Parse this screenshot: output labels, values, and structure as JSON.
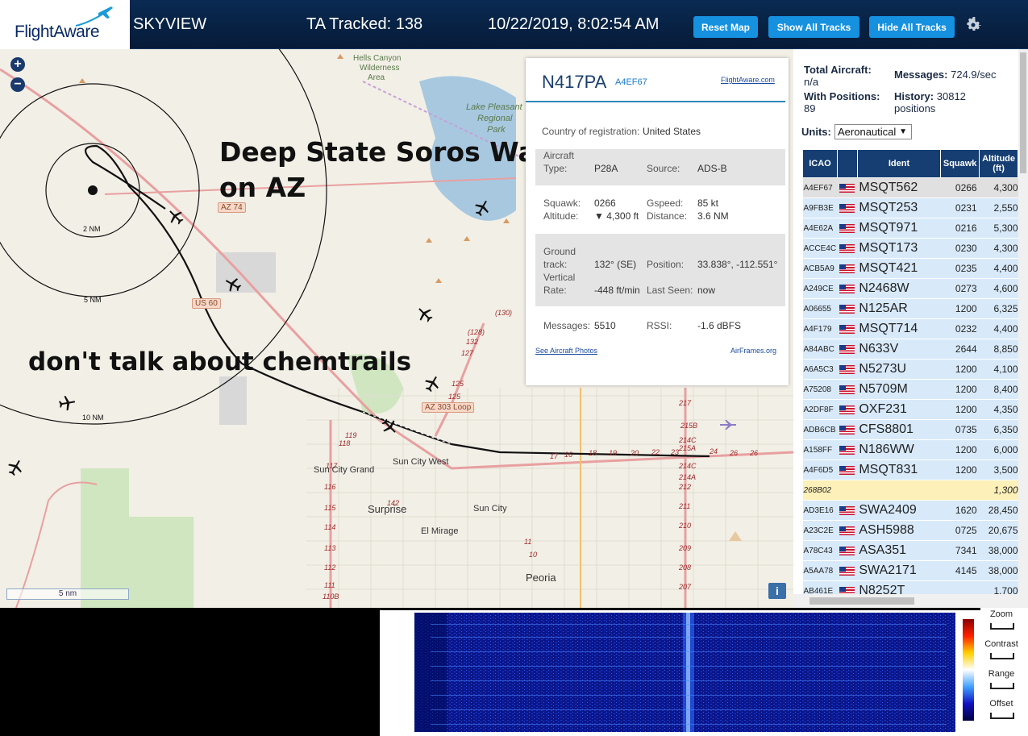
{
  "header": {
    "logo_text": "FlightAware",
    "app_name": "SKYVIEW",
    "tracked_label": "TA Tracked: 138",
    "datetime": "10/22/2019, 8:02:54 AM",
    "btn_reset": "Reset Map",
    "btn_show": "Show All Tracks",
    "btn_hide": "Hide All Tracks",
    "settings_icon": "gear-icon"
  },
  "map": {
    "zoom_in": "+",
    "zoom_out": "−",
    "overlay_line1": "Deep State Soros War",
    "overlay_line2": "on AZ",
    "overlay_line3": "don't talk about chemtrails",
    "labels": {
      "hells_canyon": "Hells Canyon",
      "wilderness": "Wilderness",
      "area": "Area",
      "lake_pleasant1": "Lake Pleasant",
      "lake_pleasant2": "Regional",
      "lake_pleasant3": "Park",
      "sun_city_grand": "Sun City Grand",
      "sun_city_west": "Sun City West",
      "surprise": "Surprise",
      "sun_city": "Sun City",
      "el_mirage": "El Mirage",
      "peoria": "Peoria",
      "ring_2nm": "2 NM",
      "ring_5nm": "5 NM",
      "ring_10nm": "10 NM"
    },
    "roads": {
      "az74": "AZ 74",
      "us60": "US 60",
      "az303": "AZ 303 Loop"
    },
    "scale": "5 nm",
    "info_button": "i"
  },
  "popup": {
    "registration": "N417PA",
    "icao": "A4EF67",
    "fa_link": "FlightAware.com",
    "country_label": "Country of registration:",
    "country_value": "United States",
    "aircraft_type_label1": "Aircraft",
    "aircraft_type_label2": "Type:",
    "aircraft_type": "P28A",
    "source_label": "Source:",
    "source": "ADS-B",
    "squawk_label": "Squawk:",
    "squawk": "0266",
    "gspeed_label": "Gspeed:",
    "gspeed": "85 kt",
    "altitude_label": "Altitude:",
    "altitude": "▼ 4,300 ft",
    "distance_label": "Distance:",
    "distance": "3.6 NM",
    "ground_label1": "Ground",
    "ground_label2": "track:",
    "ground_track": "132° (SE)",
    "position_label": "Position:",
    "position": "33.838°, -112.551°",
    "vrate_label1": "Vertical",
    "vrate_label2": "Rate:",
    "vrate": "-448 ft/min",
    "lastseen_label": "Last Seen:",
    "lastseen": "now",
    "messages_label": "Messages:",
    "messages": "5510",
    "rssi_label": "RSSI:",
    "rssi": "-1.6 dBFS",
    "photos_link": "See Aircraft Photos",
    "airframes_link": "AirFrames.org"
  },
  "sidebar": {
    "total_label": "Total Aircraft:",
    "total_value": "n/a",
    "messages_label": "Messages:",
    "messages_value": "724.9/sec",
    "withpos_label": "With Positions:",
    "withpos_value": "89",
    "history_label": "History:",
    "history_value": "30812",
    "history_unit": "positions",
    "units_label": "Units:",
    "units_value": "Aeronautical",
    "columns": [
      "ICAO",
      "",
      "Ident",
      "Squawk",
      "Altitude (ft)"
    ],
    "rows": [
      {
        "icao": "A4EF67",
        "flag": true,
        "ident": "MSQT562",
        "squawk": "0266",
        "alt": "4,300",
        "state": "sel"
      },
      {
        "icao": "A9FB3E",
        "flag": true,
        "ident": "MSQT253",
        "squawk": "0231",
        "alt": "2,550",
        "state": ""
      },
      {
        "icao": "A4E62A",
        "flag": true,
        "ident": "MSQT971",
        "squawk": "0216",
        "alt": "5,300",
        "state": ""
      },
      {
        "icao": "ACCE4C",
        "flag": true,
        "ident": "MSQT173",
        "squawk": "0230",
        "alt": "4,300",
        "state": ""
      },
      {
        "icao": "ACB5A9",
        "flag": true,
        "ident": "MSQT421",
        "squawk": "0235",
        "alt": "4,400",
        "state": ""
      },
      {
        "icao": "A249CE",
        "flag": true,
        "ident": "N2468W",
        "squawk": "0273",
        "alt": "4,600",
        "state": ""
      },
      {
        "icao": "A06655",
        "flag": true,
        "ident": "N125AR",
        "squawk": "1200",
        "alt": "6,325",
        "state": ""
      },
      {
        "icao": "A4F179",
        "flag": true,
        "ident": "MSQT714",
        "squawk": "0232",
        "alt": "4,400",
        "state": ""
      },
      {
        "icao": "A84ABC",
        "flag": true,
        "ident": "N633V",
        "squawk": "2644",
        "alt": "8,850",
        "state": ""
      },
      {
        "icao": "A6A5C3",
        "flag": true,
        "ident": "N5273U",
        "squawk": "1200",
        "alt": "4,100",
        "state": ""
      },
      {
        "icao": "A75208",
        "flag": true,
        "ident": "N5709M",
        "squawk": "1200",
        "alt": "8,400",
        "state": ""
      },
      {
        "icao": "A2DF8F",
        "flag": true,
        "ident": "OXF231",
        "squawk": "1200",
        "alt": "4,350",
        "state": ""
      },
      {
        "icao": "ADB6CB",
        "flag": true,
        "ident": "CFS8801",
        "squawk": "0735",
        "alt": "6,350",
        "state": ""
      },
      {
        "icao": "A158FF",
        "flag": true,
        "ident": "N186WW",
        "squawk": "1200",
        "alt": "6,000",
        "state": ""
      },
      {
        "icao": "A4F6D5",
        "flag": true,
        "ident": "MSQT831",
        "squawk": "1200",
        "alt": "3,500",
        "state": ""
      },
      {
        "icao": "268B02",
        "flag": false,
        "ident": "",
        "squawk": "",
        "alt": "1,300",
        "state": "nopos"
      },
      {
        "icao": "AD3E16",
        "flag": true,
        "ident": "SWA2409",
        "squawk": "1620",
        "alt": "28,450",
        "state": ""
      },
      {
        "icao": "A23C2E",
        "flag": true,
        "ident": "ASH5988",
        "squawk": "0725",
        "alt": "20,675",
        "state": ""
      },
      {
        "icao": "A78C43",
        "flag": true,
        "ident": "ASA351",
        "squawk": "7341",
        "alt": "38,000",
        "state": ""
      },
      {
        "icao": "A5AA78",
        "flag": true,
        "ident": "SWA2171",
        "squawk": "4145",
        "alt": "38,000",
        "state": ""
      },
      {
        "icao": "AB461E",
        "flag": true,
        "ident": "N8252T",
        "squawk": "",
        "alt": "1,700",
        "state": ""
      }
    ]
  },
  "spectrogram": {
    "zoom_label": "Zoom",
    "contrast_label": "Contrast",
    "range_label": "Range",
    "offset_label": "Offset"
  }
}
